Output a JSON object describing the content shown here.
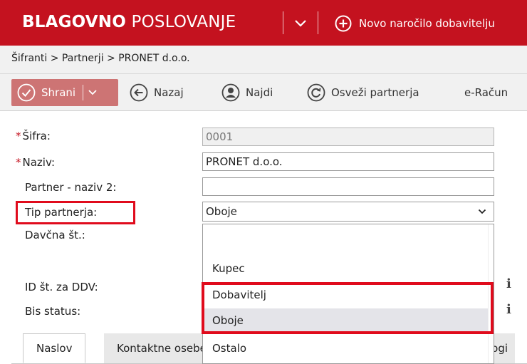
{
  "app": {
    "title_bold": "BLAGOVNO",
    "title_light": " POSLOVANJE",
    "new_order_label": "Novo naročilo dobavitelju"
  },
  "breadcrumb": "Šifranti > Partnerji > PRONET d.o.o.",
  "toolbar": {
    "save_label": "Shrani",
    "back_label": "Nazaj",
    "find_label": "Najdi",
    "refresh_label": "Osveži partnerja",
    "erac_label": "e-Račun"
  },
  "form": {
    "required_mark": "*",
    "sifra_label": "Šifra:",
    "sifra_value": "0001",
    "naziv_label": "Naziv:",
    "naziv_value": "PRONET d.o.o.",
    "naziv2_label": "Partner - naziv 2:",
    "naziv2_value": "",
    "tip_label": "Tip partnerja:",
    "tip_value": "Oboje",
    "davcna_label": "Davčna št.:",
    "ddv_label": "ID št. za DDV:",
    "bis_label": "Bis status:",
    "info_glyph": "i"
  },
  "dropdown": {
    "options": [
      "",
      "Kupec",
      "Dobavitelj",
      "Oboje",
      "Ostalo"
    ],
    "hovered": "Oboje"
  },
  "tabs": {
    "naslov": "Naslov",
    "kontaktne": "Kontaktne osebe",
    "right_fragment": "logi"
  },
  "colors": {
    "brand_red": "#c4121f",
    "highlight_red": "#e00b1c",
    "save_button": "#cd7474"
  }
}
